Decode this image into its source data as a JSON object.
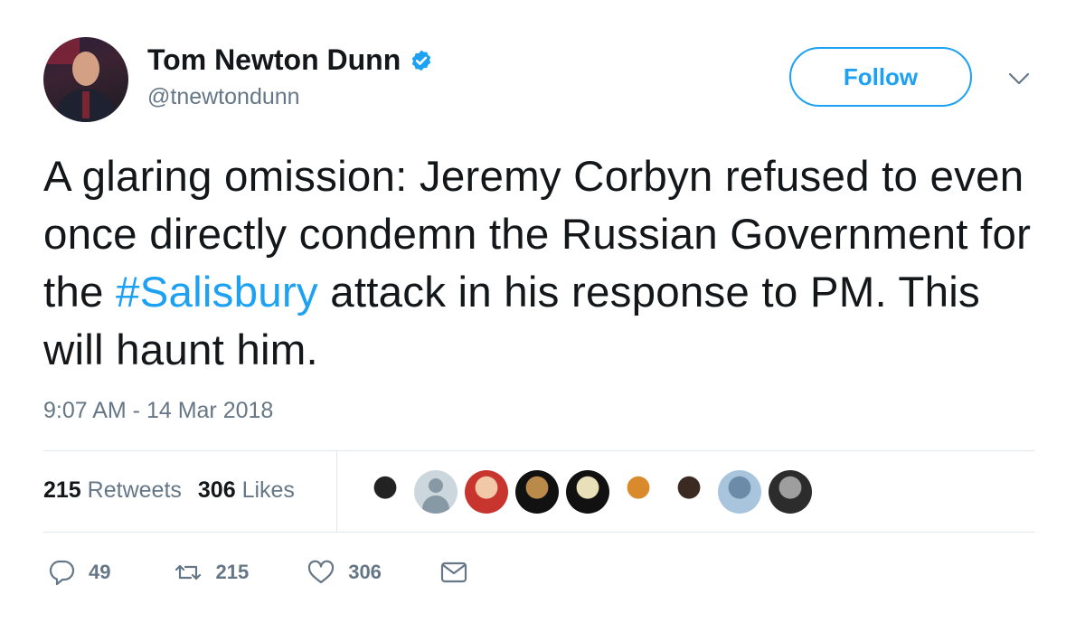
{
  "author": {
    "name": "Tom Newton Dunn",
    "handle": "@tnewtondunn",
    "verified": true
  },
  "header": {
    "follow_label": "Follow",
    "menu_icon": "chevron-down-icon"
  },
  "tweet": {
    "text_before": "A glaring omission: Jeremy Corbyn refused to even once directly condemn the Russian Government for the ",
    "hashtag": "#Salisbury",
    "text_after": " attack in his response to PM. This will haunt him.",
    "timestamp": "9:07 AM - 14 Mar 2018"
  },
  "stats": {
    "retweets_count": "215",
    "retweets_label": "Retweets",
    "likes_count": "306",
    "likes_label": "Likes"
  },
  "likers": [
    {
      "name": "liker-1",
      "colors": [
        "#ffffff",
        "#222222"
      ]
    },
    {
      "name": "liker-2-default",
      "colors": [
        "#ccd6dd",
        "#8899a6"
      ]
    },
    {
      "name": "liker-3",
      "colors": [
        "#c8352e",
        "#f1c9a9"
      ]
    },
    {
      "name": "liker-4",
      "colors": [
        "#111111",
        "#b98a4a"
      ]
    },
    {
      "name": "liker-5",
      "colors": [
        "#111111",
        "#e9dfb8"
      ]
    },
    {
      "name": "liker-6",
      "colors": [
        "#ffffff",
        "#d88a2d"
      ]
    },
    {
      "name": "liker-7",
      "colors": [
        "#ffffff",
        "#3a2a22"
      ]
    },
    {
      "name": "liker-8",
      "colors": [
        "#a9c5dd",
        "#6b8ba8"
      ]
    },
    {
      "name": "liker-9",
      "colors": [
        "#2c2c2c",
        "#9e9e9e"
      ]
    }
  ],
  "actions": {
    "replies": "49",
    "retweets": "215",
    "likes": "306"
  },
  "colors": {
    "accent": "#1da1f2",
    "secondary_text": "#657786",
    "divider": "#e1e8ed"
  }
}
